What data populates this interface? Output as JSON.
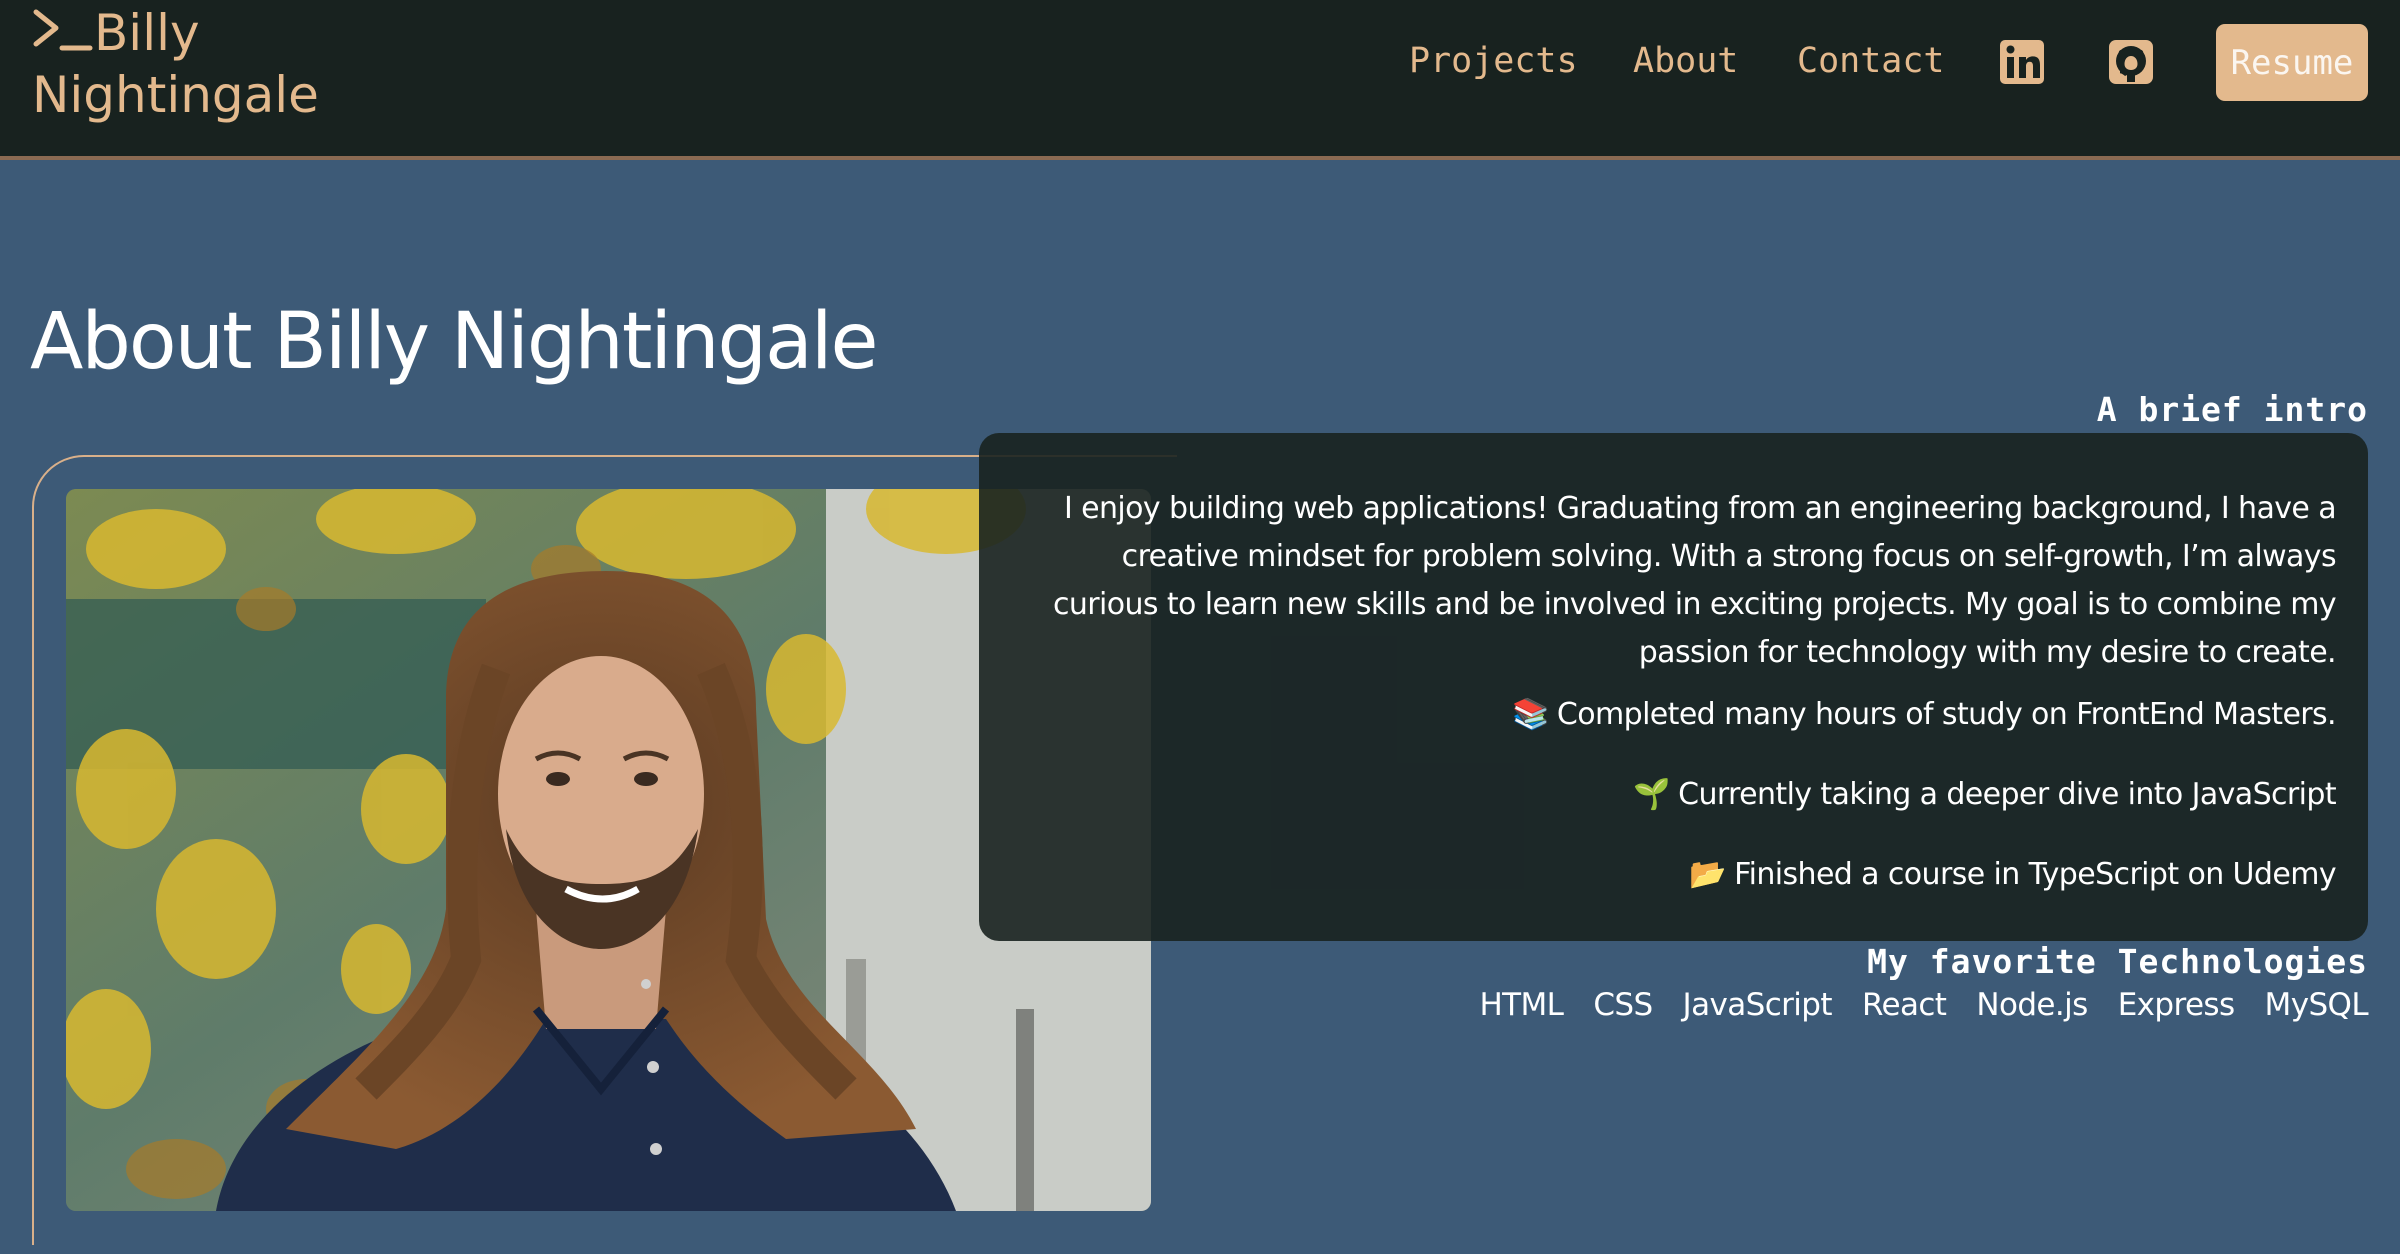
{
  "header": {
    "logo_line1": "Billy",
    "logo_line2": "Nightingale",
    "nav": [
      "Projects",
      "About",
      "Contact"
    ],
    "social": [
      "linkedin-icon",
      "github-icon"
    ],
    "resume_label": "Resume"
  },
  "about": {
    "title": "About Billy Nightingale",
    "intro_label": "A brief intro",
    "intro_text": "I enjoy building web applications! Graduating from an engineering background, I have a creative mindset for problem solving. With a strong focus on self-growth, I’m always curious to learn new skills and be involved in exciting projects. My goal is to combine my passion for technology with my desire to create.",
    "bullets": [
      {
        "emoji": "📚",
        "text": "Completed many hours of study on FrontEnd Masters."
      },
      {
        "emoji": "🌱",
        "text": "Currently taking a deeper dive into JavaScript"
      },
      {
        "emoji": "📂",
        "text": "Finished a course in TypeScript on Udemy"
      }
    ],
    "tech_label": "My favorite Technologies",
    "technologies": [
      "HTML",
      "CSS",
      "JavaScript",
      "React",
      "Node.js",
      "Express",
      "MySQL"
    ]
  },
  "colors": {
    "header_bg": "#18221f",
    "page_bg": "#3d5a77",
    "accent": "#e3b98d",
    "card_bg": "#18221f"
  }
}
